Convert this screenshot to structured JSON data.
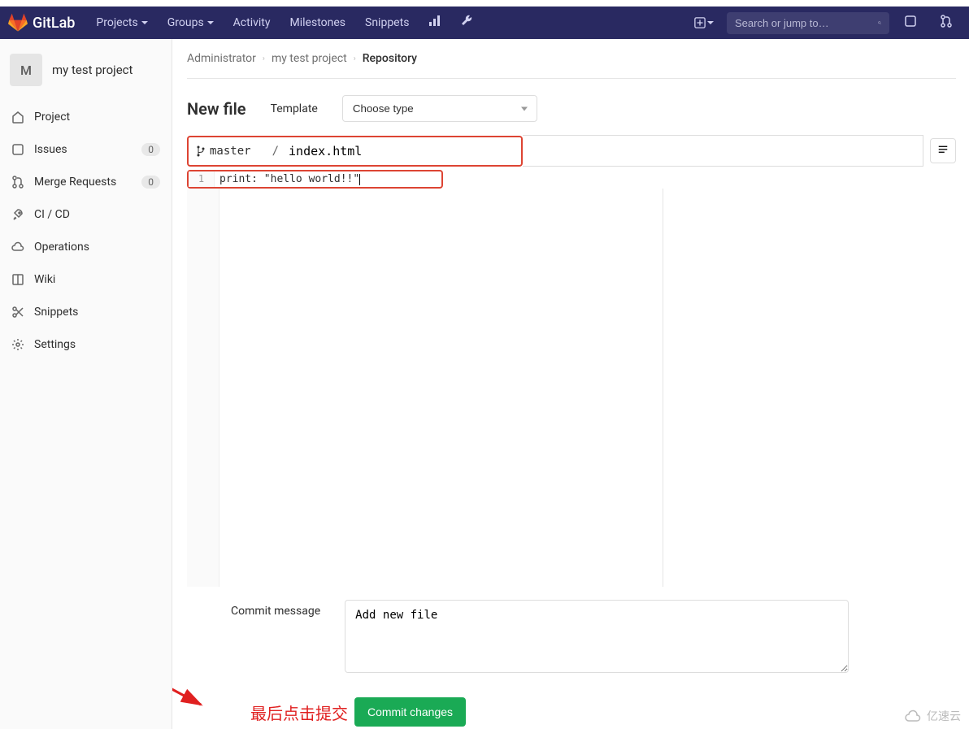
{
  "navbar": {
    "brand": "GitLab",
    "projects": "Projects",
    "groups": "Groups",
    "activity": "Activity",
    "milestones": "Milestones",
    "snippets": "Snippets",
    "search_placeholder": "Search or jump to…"
  },
  "sidebar": {
    "avatar_letter": "M",
    "project_name": "my test project",
    "items": [
      {
        "label": "Project"
      },
      {
        "label": "Issues",
        "badge": "0"
      },
      {
        "label": "Merge Requests",
        "badge": "0"
      },
      {
        "label": "CI / CD"
      },
      {
        "label": "Operations"
      },
      {
        "label": "Wiki"
      },
      {
        "label": "Snippets"
      },
      {
        "label": "Settings"
      }
    ]
  },
  "breadcrumb": {
    "root": "Administrator",
    "project": "my test project",
    "current": "Repository"
  },
  "page": {
    "title": "New file",
    "template_label": "Template",
    "template_value": "Choose type",
    "branch": "master",
    "filename": "index.html",
    "code_line_number": "1",
    "code_content": "print: \"hello world!!\"",
    "commit_label": "Commit message",
    "commit_message": "Add new file",
    "commit_button": "Commit changes"
  },
  "annotation": {
    "text": "最后点击提交"
  },
  "watermark": "亿速云"
}
